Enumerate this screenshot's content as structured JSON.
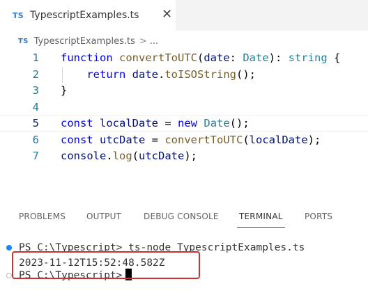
{
  "tab": {
    "badge": "TS",
    "title": "TypescriptExamples.ts",
    "close": "✕"
  },
  "breadcrumb": {
    "badge": "TS",
    "file": "TypescriptExamples.ts",
    "separator": ">",
    "more": "..."
  },
  "editor": {
    "current_line": 5,
    "lines": [
      {
        "number": "1",
        "tokens": [
          "function",
          " ",
          "convertToUTC",
          "(",
          "date",
          ": ",
          "Date",
          "): ",
          "string",
          " {"
        ]
      },
      {
        "number": "2",
        "tokens": [
          "    ",
          "return",
          " ",
          "date",
          ".",
          "toISOString",
          "();"
        ]
      },
      {
        "number": "3",
        "tokens": [
          "}"
        ]
      },
      {
        "number": "4",
        "tokens": []
      },
      {
        "number": "5",
        "tokens": [
          "const",
          " ",
          "localDate",
          " = ",
          "new",
          " ",
          "Date",
          "();"
        ]
      },
      {
        "number": "6",
        "tokens": [
          "const",
          " ",
          "utcDate",
          " = ",
          "convertToUTC",
          "(",
          "localDate",
          ");"
        ]
      },
      {
        "number": "7",
        "tokens": [
          "console",
          ".",
          "log",
          "(",
          "utcDate",
          ");"
        ]
      }
    ]
  },
  "panel": {
    "tabs": [
      "PROBLEMS",
      "OUTPUT",
      "DEBUG CONSOLE",
      "TERMINAL",
      "PORTS"
    ],
    "active_tab": "TERMINAL"
  },
  "terminal": {
    "lines": [
      "PS C:\\Typescript> ts-node TypescriptExamples.ts",
      "2023-11-12T15:52:48.582Z",
      "PS C:\\Typescript>"
    ]
  },
  "colors": {
    "keyword": "#0000ff",
    "function": "#795e26",
    "parameter": "#001080",
    "type": "#267f99",
    "line_number": "#237893",
    "highlight_border": "#d32f2f",
    "ts_badge": "#3178c6"
  }
}
